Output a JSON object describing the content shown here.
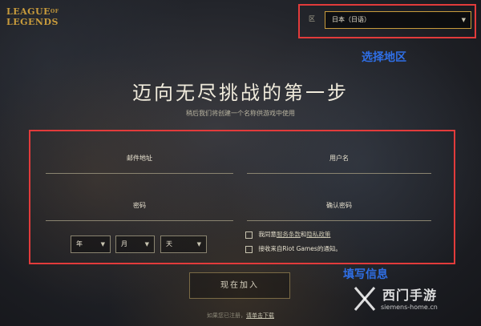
{
  "logo": {
    "line1": "LEAGUE",
    "of": "OF",
    "line2": "LEGENDS"
  },
  "region": {
    "label": "区",
    "selected": "日本（日语）"
  },
  "annotations": {
    "region": "选择地区",
    "info": "填写信息"
  },
  "heading": {
    "title": "迈向无尽挑战的第一步",
    "subtitle": "稍后我们将创建一个名称供游戏中使用"
  },
  "form": {
    "email_label": "邮件地址",
    "username_label": "用户名",
    "password_label": "密码",
    "confirm_label": "确认密码",
    "birth": {
      "year": "年",
      "month": "月",
      "day": "天"
    },
    "terms": {
      "prefix": "我同意",
      "terms_link": "服务条款",
      "and": "和",
      "privacy_link": "隐私政策"
    },
    "newsletter": "接收来自Riot Games的通知。"
  },
  "join_button": "现在加入",
  "footer": {
    "text": "如果您已注册，",
    "download": "请单击下载"
  },
  "watermark": {
    "name": "西门手游",
    "url": "siemens-home.cn"
  },
  "colors": {
    "accent_gold": "#c89b3c",
    "annotation_red": "#e23b3b",
    "annotation_blue": "#2f6fe6"
  }
}
